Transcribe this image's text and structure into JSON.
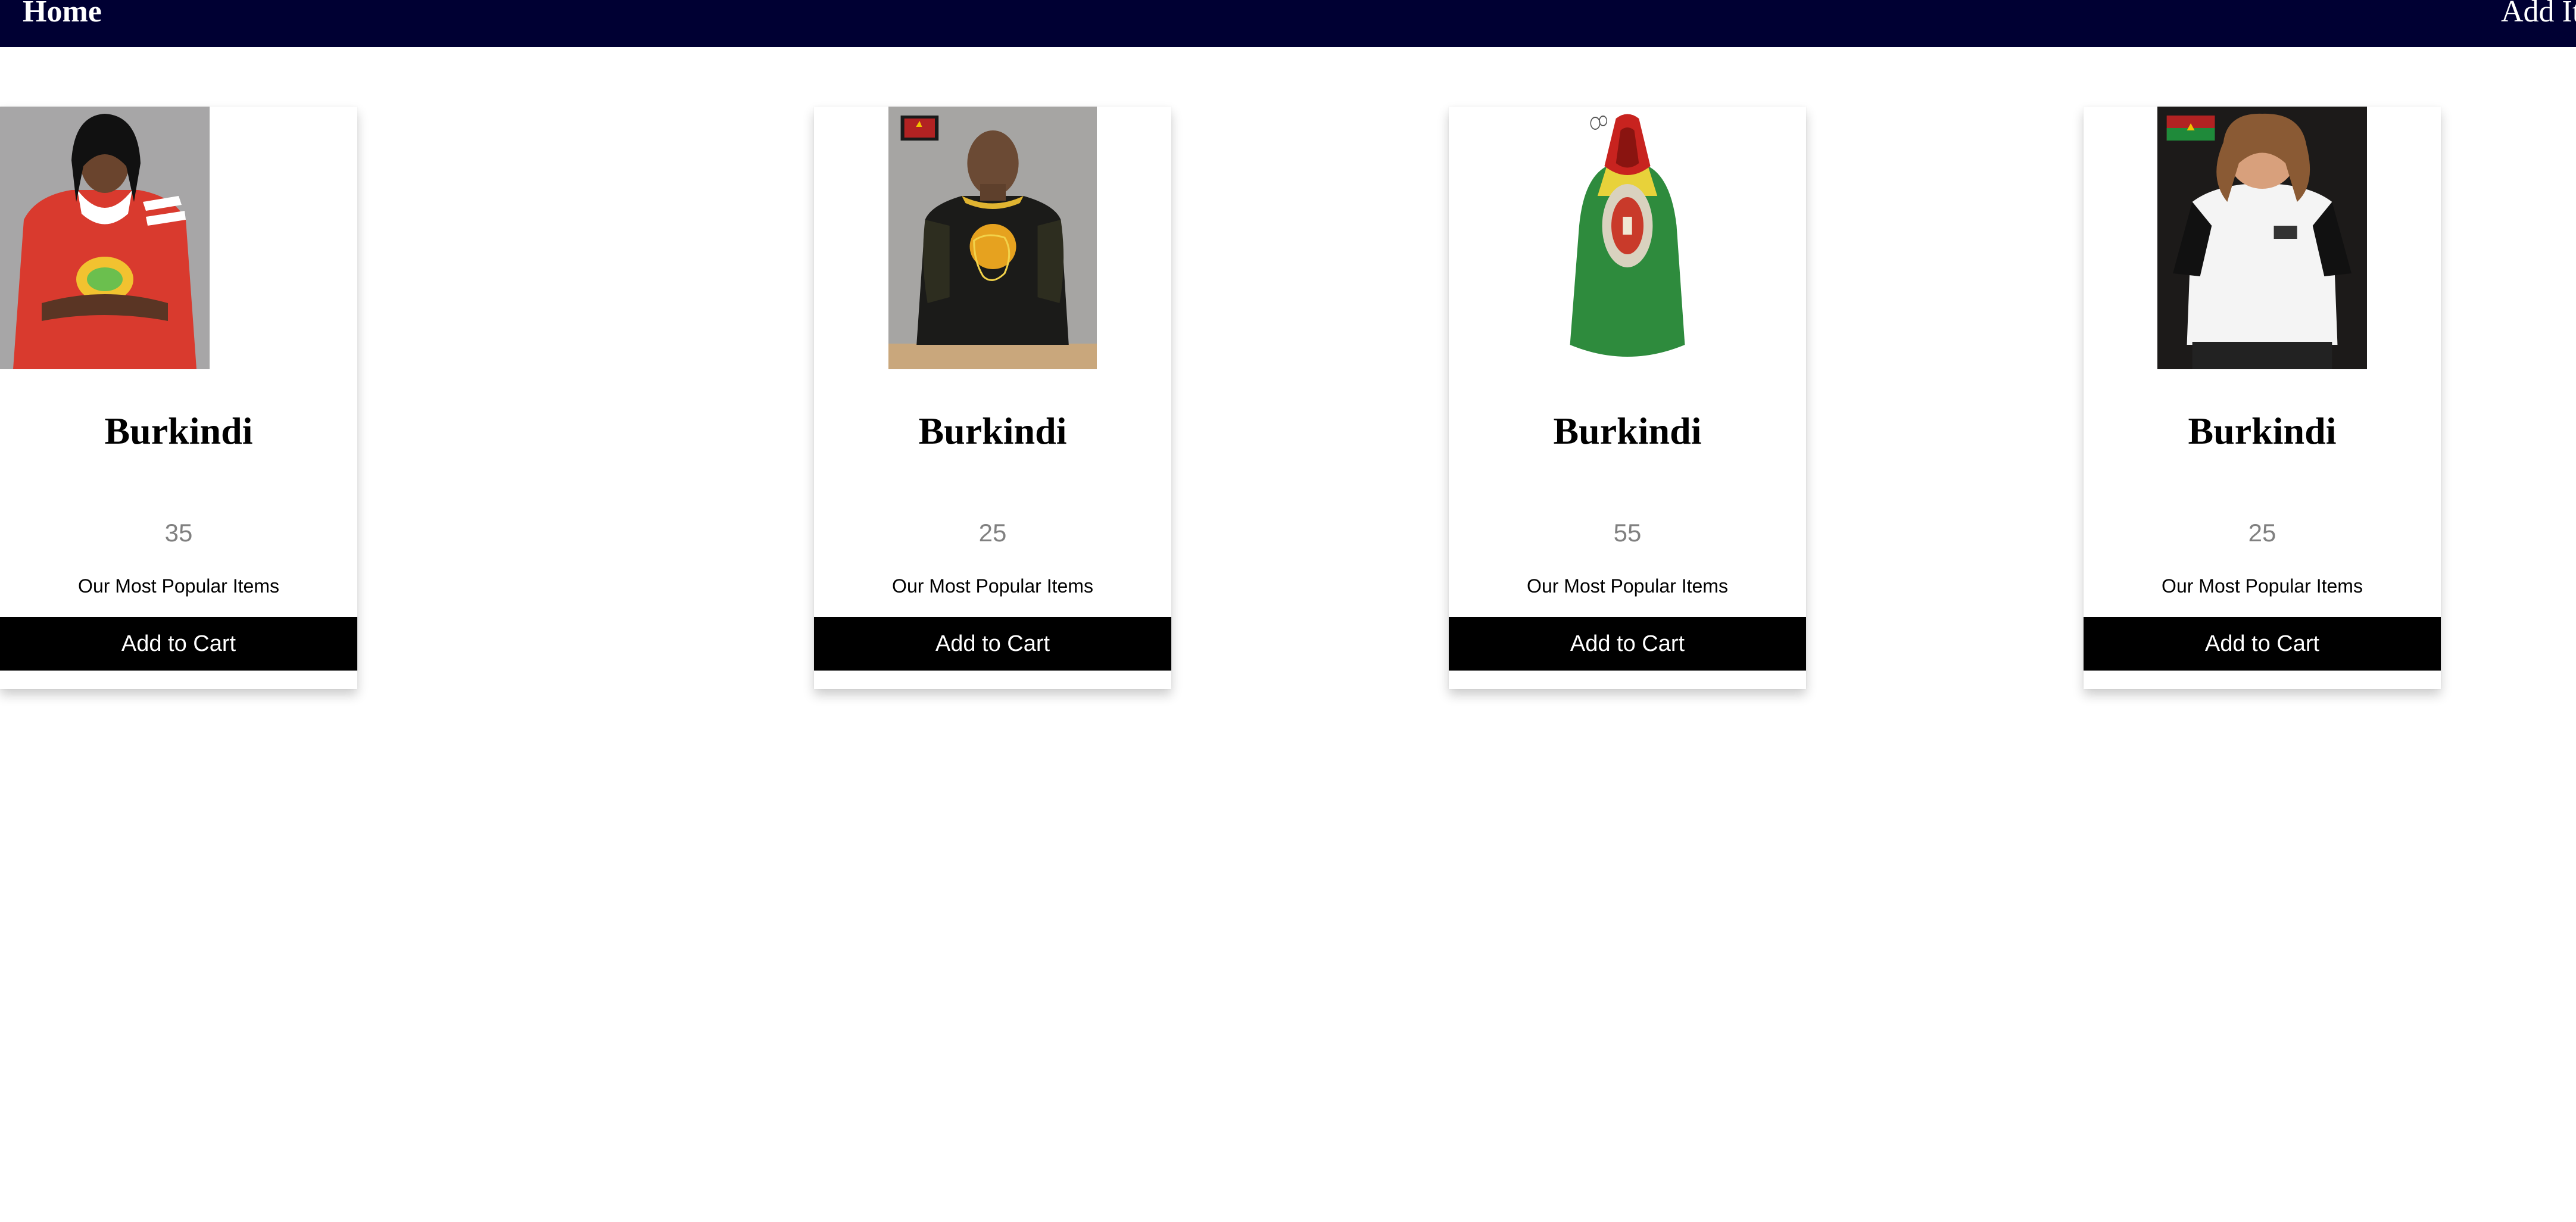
{
  "nav": {
    "home_label": "Home",
    "add_item_label": "Add It"
  },
  "products": [
    {
      "name": "Burkindi",
      "price": "25",
      "description": "Our Most Popular Items",
      "button_label": "Add to Cart"
    },
    {
      "name": "Burkindi",
      "price": "55",
      "description": "Our Most Popular Items",
      "button_label": "Add to Cart"
    },
    {
      "name": "Burkindi",
      "price": "25",
      "description": "Our Most Popular Items",
      "button_label": "Add to Cart"
    },
    {
      "name": "Burkindi",
      "price": "35",
      "description": "Our Most Popular Items",
      "button_label": "Add to Cart"
    }
  ],
  "colors": {
    "navbar": "#000033",
    "button": "#000000",
    "price_text": "#808080"
  }
}
